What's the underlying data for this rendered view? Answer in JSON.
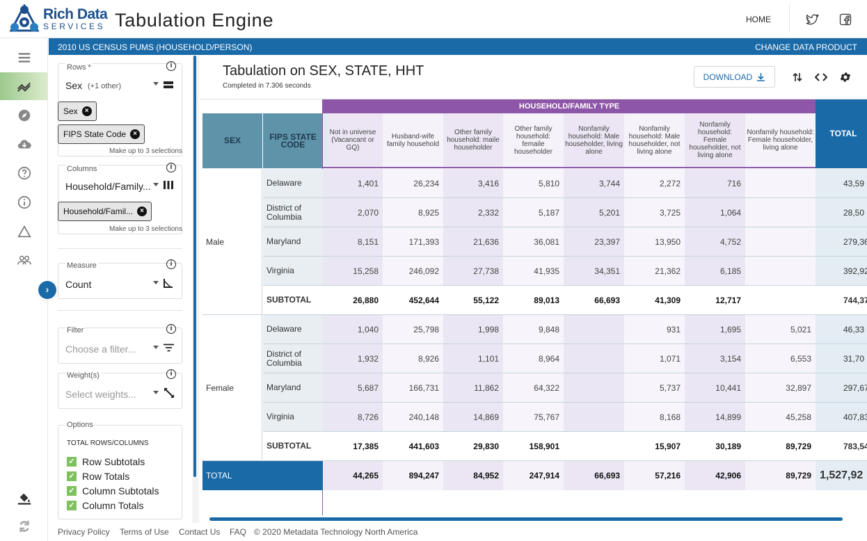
{
  "header": {
    "brand_line1": "Rich Data",
    "brand_line2": "SERVICES",
    "app_title": "Tabulation Engine",
    "nav_home": "HOME"
  },
  "bar": {
    "dataset": "2010 US CENSUS PUMS (HOUSEHOLD/PERSON)",
    "change": "CHANGE DATA PRODUCT"
  },
  "rail_icons": [
    "list-icon",
    "trend-icon",
    "compass-icon",
    "cloud-download-icon",
    "help-icon",
    "info-icon",
    "triangle-icon",
    "people-icon",
    "paint-bucket-icon",
    "refresh-icon"
  ],
  "panel": {
    "rows": {
      "label": "Rows *",
      "value": "Sex",
      "extra": "(+1 other)",
      "chips": [
        "Sex",
        "FIPS State Code"
      ],
      "hint": "Make up to 3 selections"
    },
    "columns": {
      "label": "Columns",
      "value": "Household/Family...",
      "chips": [
        "Household/Famil..."
      ],
      "hint": "Make up to 3 selections"
    },
    "measure": {
      "label": "Measure",
      "value": "Count"
    },
    "filter": {
      "label": "Filter",
      "placeholder": "Choose a filter..."
    },
    "weights": {
      "label": "Weight(s)",
      "placeholder": "Select weights..."
    },
    "options": {
      "label": "Options",
      "section": "TOTAL ROWS/COLUMNS",
      "checks": [
        "Row Subtotals",
        "Row Totals",
        "Column Subtotals",
        "Column Totals"
      ]
    }
  },
  "main": {
    "title": "Tabulation on SEX, STATE, HHT",
    "subtitle": "Completed in 7.306 seconds",
    "download": "DOWNLOAD"
  },
  "table": {
    "group_header": "HOUSEHOLD/FAMILY TYPE",
    "row_header_1": "SEX",
    "row_header_2": "FIPS STATE CODE",
    "columns": [
      "Not in universe (Vacancant or GQ)",
      "Husband-wife family household",
      "Other family household: maile householder",
      "Other family household: femaile householder",
      "Nonfamily household: Male householder, living alone",
      "Nonfamily household: Male householder, not living alone",
      "Nonfamily household: Female householder, not living alone",
      "Nonfamily household: Female householder, living alone"
    ],
    "total_header": "TOTAL",
    "groups": [
      {
        "name": "Male",
        "rows": [
          {
            "state": "Delaware",
            "values": [
              "1,401",
              "26,234",
              "3,416",
              "5,810",
              "3,744",
              "2,272",
              "716",
              ""
            ],
            "total": "43,59"
          },
          {
            "state": "District of Columbia",
            "values": [
              "2,070",
              "8,925",
              "2,332",
              "5,187",
              "5,201",
              "3,725",
              "1,064",
              ""
            ],
            "total": "28,50"
          },
          {
            "state": "Maryland",
            "values": [
              "8,151",
              "171,393",
              "21,636",
              "36,081",
              "23,397",
              "13,950",
              "4,752",
              ""
            ],
            "total": "279,36"
          },
          {
            "state": "Virginia",
            "values": [
              "15,258",
              "246,092",
              "27,738",
              "41,935",
              "34,351",
              "21,362",
              "6,185",
              ""
            ],
            "total": "392,92"
          }
        ],
        "subtotal": {
          "label": "SUBTOTAL",
          "values": [
            "26,880",
            "452,644",
            "55,122",
            "89,013",
            "66,693",
            "41,309",
            "12,717",
            ""
          ],
          "total": "744,37"
        }
      },
      {
        "name": "Female",
        "rows": [
          {
            "state": "Delaware",
            "values": [
              "1,040",
              "25,798",
              "1,998",
              "9,848",
              "",
              "931",
              "1,695",
              "5,021"
            ],
            "total": "46,33"
          },
          {
            "state": "District of Columbia",
            "values": [
              "1,932",
              "8,926",
              "1,101",
              "8,964",
              "",
              "1,071",
              "3,154",
              "6,553"
            ],
            "total": "31,70"
          },
          {
            "state": "Maryland",
            "values": [
              "5,687",
              "166,731",
              "11,862",
              "64,322",
              "",
              "5,737",
              "10,441",
              "32,897"
            ],
            "total": "297,67"
          },
          {
            "state": "Virginia",
            "values": [
              "8,726",
              "240,148",
              "14,869",
              "75,767",
              "",
              "8,168",
              "14,899",
              "45,258"
            ],
            "total": "407,83"
          }
        ],
        "subtotal": {
          "label": "SUBTOTAL",
          "values": [
            "17,385",
            "441,603",
            "29,830",
            "158,901",
            "",
            "15,907",
            "30,189",
            "89,729"
          ],
          "total": "783,54"
        }
      }
    ],
    "grand_total": {
      "label": "TOTAL",
      "values": [
        "44,265",
        "894,247",
        "84,952",
        "247,914",
        "66,693",
        "57,216",
        "42,906",
        "89,729"
      ],
      "total": "1,527,92"
    }
  },
  "footer": {
    "links": [
      "Privacy Policy",
      "Terms of Use",
      "Contact Us",
      "FAQ"
    ],
    "copyright": "© 2020 Metadata Technology North America"
  }
}
